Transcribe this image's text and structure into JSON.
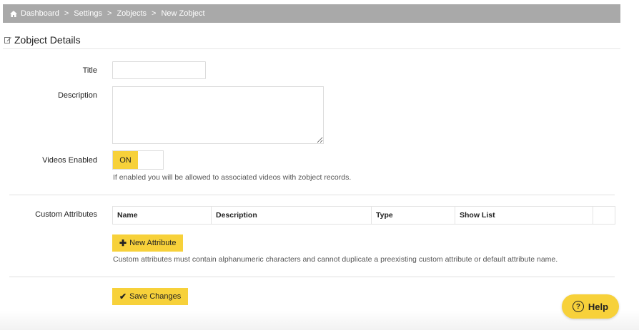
{
  "breadcrumb": {
    "items": [
      "Dashboard",
      "Settings",
      "Zobjects",
      "New Zobject"
    ],
    "separator": ">"
  },
  "page": {
    "section_title": "Zobject Details"
  },
  "form": {
    "title_label": "Title",
    "title_value": "",
    "description_label": "Description",
    "description_value": "",
    "videos_label": "Videos Enabled",
    "videos_toggle_state": "ON",
    "videos_help": "If enabled you will be allowed to associated videos with zobject records.",
    "custom_attributes_label": "Custom Attributes",
    "table_headers": [
      "Name",
      "Description",
      "Type",
      "Show List",
      ""
    ],
    "new_attribute_button": "New Attribute",
    "attribute_help": "Custom attributes must contain alphanumeric characters and cannot duplicate a preexisting custom attribute or default attribute name.",
    "save_button": "Save Changes"
  },
  "help_widget": {
    "label": "Help"
  },
  "colors": {
    "accent": "#f7d13a",
    "breadcrumb_bg": "#a9a9a9"
  }
}
